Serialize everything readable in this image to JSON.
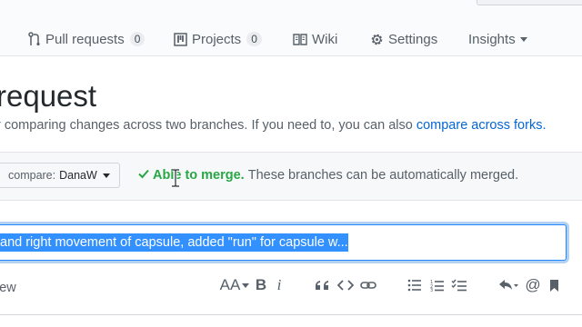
{
  "repo_nav": {
    "tabs": [
      {
        "label": "Pull requests",
        "count": "0",
        "icon": "git-pull-request-icon"
      },
      {
        "label": "Projects",
        "count": "0",
        "icon": "project-icon"
      },
      {
        "label": "Wiki",
        "icon": "book-icon"
      },
      {
        "label": "Settings",
        "icon": "gear-icon"
      },
      {
        "label": "Insights",
        "icon": "chevron-down-icon"
      }
    ]
  },
  "page": {
    "title": "request",
    "subtitle": "r comparing changes across two branches. If you need to, you can also",
    "compare_forks_link": "compare across forks."
  },
  "compare": {
    "label": "compare:",
    "branch": "DanaW"
  },
  "merge": {
    "status": "Able to merge.",
    "note": "These branches can be automatically merged."
  },
  "pr_form": {
    "title_value": "and right movement of capsule, added \"run\" for capsule w..."
  },
  "editor": {
    "tab_label": "iew",
    "toolbar": {
      "text_size": "AA",
      "bold": "B",
      "italic": "i",
      "mention": "@"
    }
  },
  "colors": {
    "link": "#0366d6",
    "success": "#28a745",
    "focus": "#2188ff",
    "selection": "#3390ff"
  }
}
